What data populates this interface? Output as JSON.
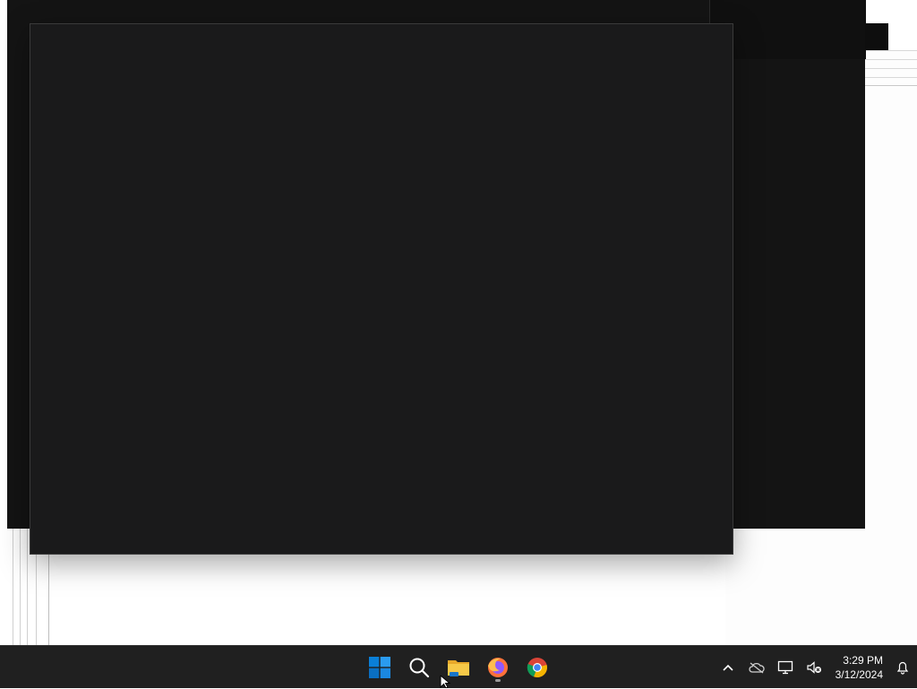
{
  "taskbar": {
    "apps": [
      {
        "name": "start",
        "icon": "windows-logo-icon"
      },
      {
        "name": "search",
        "icon": "search-icon"
      },
      {
        "name": "file-explorer",
        "icon": "folder-icon"
      },
      {
        "name": "firefox",
        "icon": "firefox-icon"
      },
      {
        "name": "chrome",
        "icon": "chrome-icon"
      }
    ],
    "tray": {
      "icons": [
        "chevron-up-icon",
        "onedrive-cloud-icon",
        "network-icon",
        "volume-muted-icon",
        "notification-bell-icon"
      ],
      "time": "3:29 PM",
      "date": "3/12/2024"
    }
  },
  "colors": {
    "taskbar_bg": "#202020",
    "window_bg": "#1a1a1b",
    "desktop_bg": "#ffffff",
    "start_blue": "#0078d4"
  }
}
